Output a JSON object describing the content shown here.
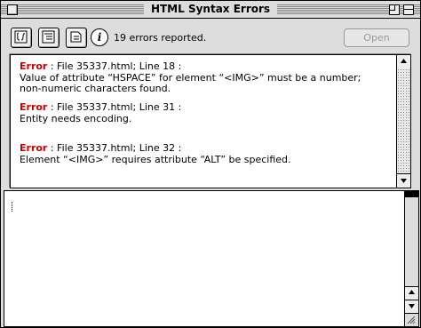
{
  "window": {
    "title": "HTML Syntax Errors"
  },
  "toolbar": {
    "buttons": [
      {
        "name": "edit-source-icon"
      },
      {
        "name": "list-view-icon"
      },
      {
        "name": "document-icon"
      }
    ],
    "info_icon": "i",
    "status_text": "19 errors reported.",
    "open_label": "Open"
  },
  "errors": [
    {
      "label": "Error",
      "location": " : File 35337.html; Line 18 :",
      "lines": [
        "Value of attribute “HSPACE” for element “<IMG>” must be a number;",
        "non-numeric characters found."
      ]
    },
    {
      "label": "Error",
      "location": " : File 35337.html; Line 31 :",
      "lines": [
        "Entity needs encoding."
      ]
    },
    {
      "label": "Error",
      "location": " : File 35337.html; Line 32 :",
      "lines": [
        "Element “<IMG>” requires attribute “ALT” be specified."
      ]
    }
  ],
  "colors": {
    "error_label": "#cc0000",
    "chrome": "#dddddd"
  }
}
